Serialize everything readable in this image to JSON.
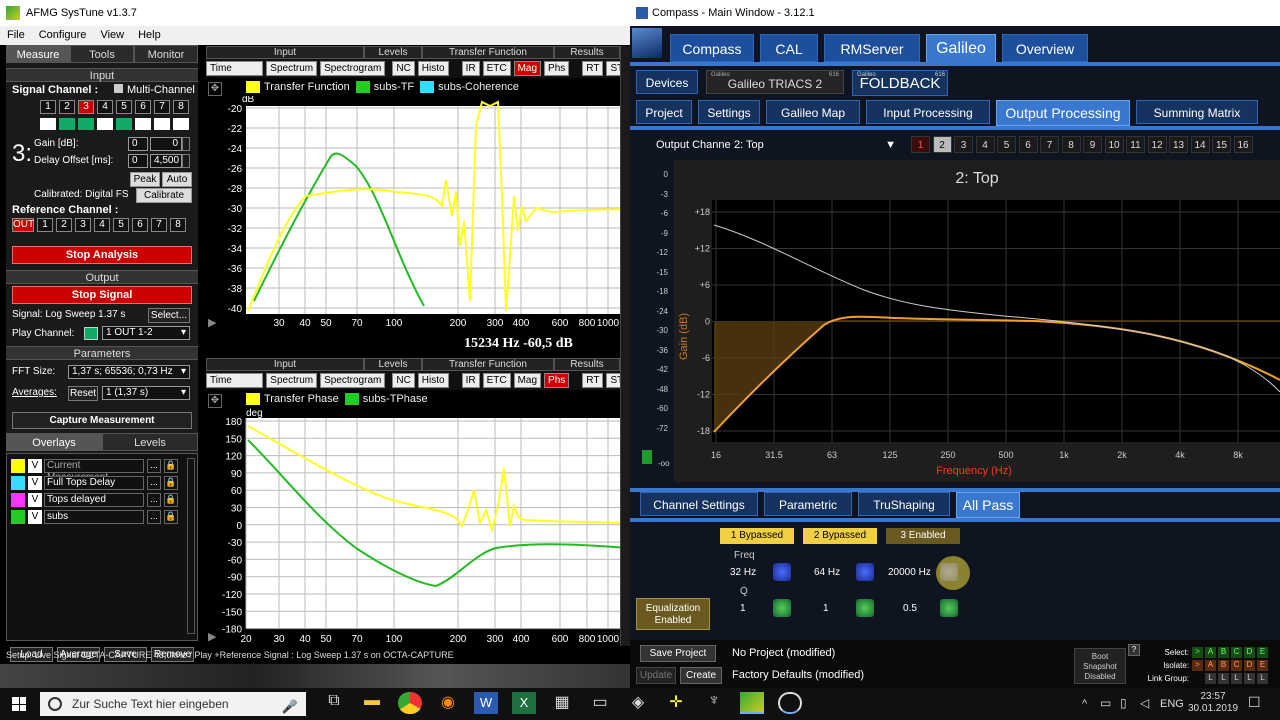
{
  "systune": {
    "title": "AFMG SysTune v1.3.7",
    "menu": [
      "File",
      "Configure",
      "View",
      "Help"
    ],
    "tabs": [
      "Measure",
      "Tools",
      "Monitor"
    ],
    "input_header": "Input",
    "signal_channel_label": "Signal Channel :",
    "multichannel_label": "Multi-Channel",
    "channels": [
      "1",
      "2",
      "3",
      "4",
      "5",
      "6",
      "7",
      "8"
    ],
    "channel_big": "3:",
    "gain_label": "Gain [dB]:",
    "gain_values": [
      "0",
      "0"
    ],
    "delay_label": "Delay Offset [ms]:",
    "delay_values": [
      "0",
      "4,500"
    ],
    "peak_label": "Peak",
    "auto_label": "Auto",
    "calibrated_label": "Calibrated: Digital FS",
    "calibrate_btn": "Calibrate",
    "reference_label": "Reference Channel :",
    "ref_out": "OUT",
    "stop_analysis": "Stop Analysis",
    "output_header": "Output",
    "stop_signal": "Stop Signal",
    "signal_text": "Signal: Log Sweep  1.37 s",
    "select_btn": "Select...",
    "play_channel_label": "Play Channel:",
    "play_channel_value": "1 OUT 1-2",
    "parameters_header": "Parameters",
    "fft_label": "FFT Size:",
    "fft_value": "1,37 s; 65536; 0,73 Hz",
    "averages_label": "Averages:",
    "reset_btn": "Reset",
    "averages_value": "1 (1,37 s)",
    "capture_btn": "Capture Measurement",
    "overlay_tabs": [
      "Overlays",
      "Levels"
    ],
    "overlays": [
      {
        "name": "Current Measurement",
        "color": "#ffff00",
        "v": "V"
      },
      {
        "name": "Full Tops Delay",
        "color": "#33ddff",
        "v": "V"
      },
      {
        "name": "Tops delayed",
        "color": "#ff33ff",
        "v": "V"
      },
      {
        "name": "subs",
        "color": "#22cc22",
        "v": "V"
      }
    ],
    "bottom_buttons": [
      "Load",
      "Average",
      "Save",
      "Remove"
    ],
    "toolbar_groups": [
      "Input",
      "Levels",
      "Transfer Function",
      "Results"
    ],
    "toolbar_input": [
      "Time Signal",
      "Spectrum",
      "Spectrogram"
    ],
    "toolbar_levels": [
      "NC",
      "Histo"
    ],
    "toolbar_tf_top": [
      "IR",
      "ETC",
      "Mag",
      "Phs"
    ],
    "toolbar_results": [
      "RT",
      "STI"
    ],
    "legend_top": [
      {
        "label": "Transfer Function",
        "color": "#ffff22"
      },
      {
        "label": "subs-TF",
        "color": "#22cc22"
      },
      {
        "label": "subs-Coherence",
        "color": "#33ddff"
      }
    ],
    "legend_bottom": [
      {
        "label": "Transfer Phase",
        "color": "#ffff22"
      },
      {
        "label": "subs-TPhase",
        "color": "#22cc22"
      }
    ],
    "top_chart": {
      "yunit": "dB",
      "yticks": [
        "-20",
        "-22",
        "-24",
        "-26",
        "-28",
        "-30",
        "-32",
        "-34",
        "-36",
        "-38",
        "-40"
      ],
      "xticks": [
        "30",
        "40",
        "50",
        "70",
        "100",
        "200",
        "300",
        "400",
        "600",
        "800",
        "1000"
      ],
      "readout": "15234 Hz   -60,5 dB"
    },
    "bottom_chart": {
      "yunit": "deg",
      "yticks": [
        "180",
        "150",
        "120",
        "90",
        "60",
        "30",
        "0",
        "-30",
        "-60",
        "-90",
        "-120",
        "-150",
        "-180"
      ],
      "xticks": [
        "20",
        "30",
        "40",
        "50",
        "70",
        "100",
        "200",
        "300",
        "400",
        "600",
        "800",
        "1000"
      ]
    },
    "status": "Setup: Live Signal OCTA-CAPTURE 48,0kHz / Play +Reference Signal : Log Sweep  1.37 s on OCTA-CAPTURE"
  },
  "compass": {
    "title": "Compass - Main Window - 3.12.1",
    "main_tabs": [
      "Compass",
      "CAL",
      "RMServer",
      "Galileo",
      "Overview"
    ],
    "active_main": "Galileo",
    "devices_label": "Devices",
    "device_tabs": [
      {
        "label": "Galileo TRIACS 2",
        "small": "Galileo",
        "sup": "616"
      },
      {
        "label": "FOLDBACK",
        "small": "Galileo",
        "sup": "616"
      }
    ],
    "sub_tabs": [
      "Project",
      "Settings",
      "Galileo Map",
      "Input Processing",
      "Output Processing",
      "Summing Matrix"
    ],
    "active_sub": "Output Processing",
    "output_channel_label": "Output Channel:",
    "output_channel_value": "2: Top",
    "channel_buttons": [
      "1",
      "2",
      "3",
      "4",
      "5",
      "6",
      "7",
      "8",
      "9",
      "10",
      "11",
      "12",
      "13",
      "14",
      "15",
      "16"
    ],
    "meter_ticks": [
      "0",
      "-3",
      "-6",
      "-9",
      "-12",
      "-15",
      "-18",
      "-24",
      "-30",
      "-36",
      "-42",
      "-48",
      "-60",
      "-72"
    ],
    "meter_bottom": "-oo",
    "graph_title": "2: Top",
    "gain_axis_label": "Gain (dB)",
    "freq_axis_label": "Frequency (Hz)",
    "yticks": [
      "+18",
      "+12",
      "+6",
      "0",
      "-6",
      "-12",
      "-18"
    ],
    "xticks": [
      "16",
      "31.5",
      "63",
      "125",
      "250",
      "500",
      "1k",
      "2k",
      "4k",
      "8k"
    ],
    "bottom_tabs": [
      "Channel Settings",
      "Parametric",
      "TruShaping",
      "All Pass"
    ],
    "active_bottom": "All Pass",
    "bypass_buttons": [
      "1 Bypassed",
      "2 Bypassed",
      "3 Enabled"
    ],
    "freq_label": "Freq",
    "freqs": [
      "32 Hz",
      "64 Hz",
      "20000 Hz"
    ],
    "q_label": "Q",
    "qs": [
      "1",
      "1",
      "0.5"
    ],
    "eq_enabled": "Equalization Enabled",
    "save_project": "Save Project",
    "project_status": "No Project (modified)",
    "update_btn": "Update",
    "create_btn": "Create",
    "factory_status": "Factory Defaults (modified)",
    "boot_snapshot": "Boot Snapshot Disabled",
    "help_btn": "?",
    "select_label": "Select:",
    "isolate_label": "Isolate:",
    "linkgroup_label": "Link Group:",
    "letters": [
      "A",
      "B",
      "C",
      "D",
      "E"
    ],
    "arrow": ">",
    "link_l": "L"
  },
  "taskbar": {
    "search_placeholder": "Zur Suche Text hier eingeben",
    "lang": "ENG",
    "time": "23:57",
    "date": "30.01.2019"
  }
}
